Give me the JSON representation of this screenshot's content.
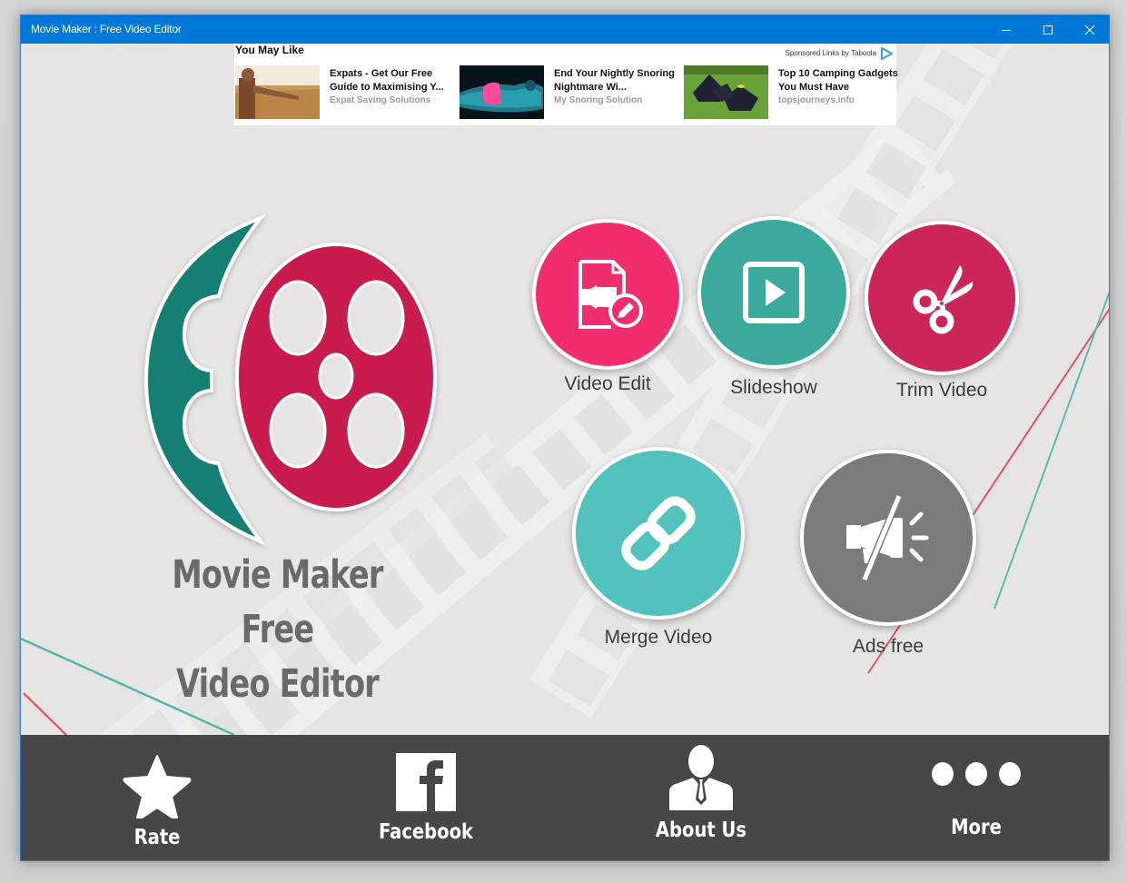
{
  "window": {
    "title": "Movie Maker : Free Video Editor",
    "controls": {
      "minimize": "minimize",
      "maximize": "maximize",
      "close": "close"
    },
    "titlebar_color": "#0078d7"
  },
  "ad": {
    "heading": "You May Like",
    "sponsored": "Sponsored Links by Taboola",
    "items": [
      {
        "title": "Expats - Get Our Free Guide to Maximising Y...",
        "source": "Expat Saving Solutions"
      },
      {
        "title": "End Your Nightly Snoring Nightmare Wi...",
        "source": "My Snoring Solution"
      },
      {
        "title": "Top 10 Camping Gadgets You Must Have",
        "source": "topsjourneys.info"
      }
    ]
  },
  "app": {
    "name_line1": "Movie Maker Free",
    "name_line2": "Video Editor"
  },
  "features": [
    {
      "label": "Video Edit",
      "icon": "video-edit-icon",
      "color": "#ef2e6b"
    },
    {
      "label": "Slideshow",
      "icon": "play-icon",
      "color": "#3ba99c"
    },
    {
      "label": "Trim Video",
      "icon": "scissors-icon",
      "color": "#cb2657"
    },
    {
      "label": "Merge Video",
      "icon": "link-icon",
      "color": "#54c2bc"
    },
    {
      "label": "Ads free",
      "icon": "no-ads-icon",
      "color": "#7b7b7d"
    }
  ],
  "bottom_nav": [
    {
      "label": "Rate",
      "icon": "star-icon"
    },
    {
      "label": "Facebook",
      "icon": "facebook-icon"
    },
    {
      "label": "About Us",
      "icon": "user-icon"
    },
    {
      "label": "More",
      "icon": "more-icon"
    }
  ],
  "colors": {
    "logo_teal": "#137f73",
    "logo_red": "#c81b4f",
    "bottom_bar": "#464749",
    "background": "#e6e5e4"
  }
}
